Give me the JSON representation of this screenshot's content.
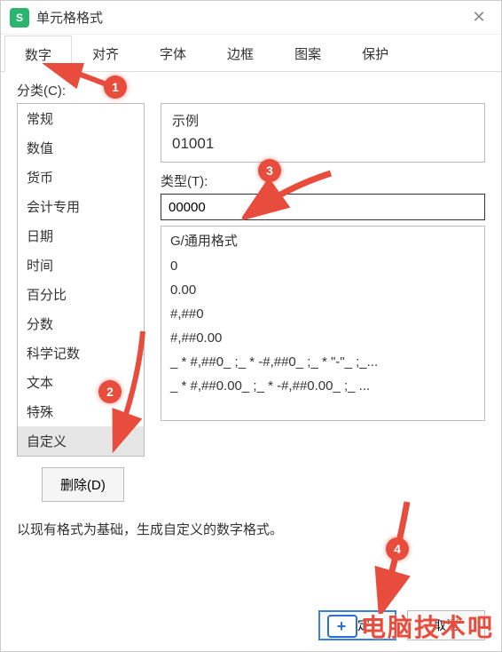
{
  "window": {
    "title": "单元格格式",
    "app_icon_letter": "S"
  },
  "tabs": [
    {
      "label": "数字",
      "active": true
    },
    {
      "label": "对齐",
      "active": false
    },
    {
      "label": "字体",
      "active": false
    },
    {
      "label": "边框",
      "active": false
    },
    {
      "label": "图案",
      "active": false
    },
    {
      "label": "保护",
      "active": false
    }
  ],
  "category": {
    "label": "分类(C):",
    "items": [
      "常规",
      "数值",
      "货币",
      "会计专用",
      "日期",
      "时间",
      "百分比",
      "分数",
      "科学记数",
      "文本",
      "特殊",
      "自定义"
    ],
    "selected_index": 11
  },
  "example": {
    "label": "示例",
    "value": "01001"
  },
  "type": {
    "label": "类型(T):",
    "value": "00000"
  },
  "format_list": [
    "G/通用格式",
    "0",
    "0.00",
    "#,##0",
    "#,##0.00",
    "_ * #,##0_ ;_ * -#,##0_ ;_ * \"-\"_ ;_...",
    "_ * #,##0.00_ ;_ * -#,##0.00_ ;_ ..."
  ],
  "delete_button": "删除(D)",
  "hint": "以现有格式为基础，生成自定义的数字格式。",
  "footer": {
    "ok": "确定",
    "cancel": "取消"
  },
  "annotations": {
    "dots": [
      "1",
      "2",
      "3",
      "4"
    ]
  },
  "watermark": "电脑技术吧"
}
